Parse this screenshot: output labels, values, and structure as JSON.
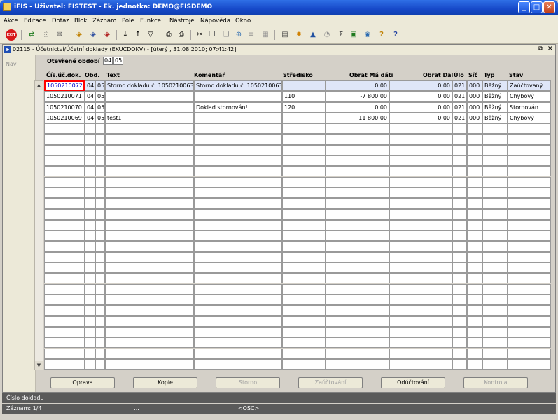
{
  "app": {
    "title": "iFIS - Uživatel: FISTEST - Ek. jednotka: DEMO@FISDEMO"
  },
  "menu": [
    "Akce",
    "Editace",
    "Dotaz",
    "Blok",
    "Záznam",
    "Pole",
    "Funkce",
    "Nástroje",
    "Nápověda",
    "Okno"
  ],
  "toolbar": {
    "exit_label": "EXIT",
    "icons": [
      "save-icon",
      "print-preview-icon",
      "mail-icon",
      "query-icon",
      "query-run-icon",
      "query-cancel-icon",
      "sort-asc-icon",
      "sort-desc-icon",
      "filter-icon",
      "print-icon",
      "print-setup-icon",
      "cut-icon",
      "copy-icon",
      "paste-icon",
      "insert-record-icon",
      "delete-record-icon",
      "grid-icon",
      "calculator-icon",
      "sun-icon",
      "attachment-icon",
      "chart-icon",
      "sum-icon",
      "excel-icon",
      "refresh-icon",
      "help-icon",
      "about-icon"
    ]
  },
  "window": {
    "title": "02115 - Účetnictví/Účetní doklady (EKUCDOKV) - [úterý  , 31.08.2010; 07:41:42]",
    "nav_label": "Nav",
    "period_label": "Otevřené období",
    "period_year": "04",
    "period_month": "05"
  },
  "columns": [
    "Čís.úč.dok.",
    "Obd.",
    "Text",
    "Komentář",
    "Středisko",
    "Obrat Má dáti",
    "Obrat Dal",
    "Úlo",
    "Síť",
    "Typ",
    "Stav"
  ],
  "rows": [
    {
      "cislo": "1050210072",
      "obd1": "04",
      "obd2": "05",
      "text": "Storno dokladu č. 1050210063",
      "komentar": "Storno dokladu č. 1050210063",
      "stredisko": "",
      "md": "0.00",
      "dal": "0.00",
      "ulo": "021",
      "sit": "000",
      "typ": "Běžný",
      "stav": "Zaúčtovaný"
    },
    {
      "cislo": "1050210071",
      "obd1": "04",
      "obd2": "05",
      "text": "",
      "komentar": "",
      "stredisko": "110",
      "md": "-7 800.00",
      "dal": "0.00",
      "ulo": "021",
      "sit": "000",
      "typ": "Běžný",
      "stav": "Chybový"
    },
    {
      "cislo": "1050210070",
      "obd1": "04",
      "obd2": "05",
      "text": "",
      "komentar": "Doklad stornován!",
      "stredisko": "120",
      "md": "0.00",
      "dal": "0.00",
      "ulo": "021",
      "sit": "000",
      "typ": "Běžný",
      "stav": "Stornován"
    },
    {
      "cislo": "1050210069",
      "obd1": "04",
      "obd2": "05",
      "text": "test1",
      "komentar": "",
      "stredisko": "",
      "md": "11 800.00",
      "dal": "0.00",
      "ulo": "021",
      "sit": "000",
      "typ": "Běžný",
      "stav": "Chybový"
    }
  ],
  "buttons": [
    {
      "label": "Oprava",
      "enabled": true
    },
    {
      "label": "Kopie",
      "enabled": true
    },
    {
      "label": "Storno",
      "enabled": false
    },
    {
      "label": "Zaúčtování",
      "enabled": false
    },
    {
      "label": "Odúčtování",
      "enabled": true
    },
    {
      "label": "Kontrola",
      "enabled": false
    }
  ],
  "status": {
    "hint": "Číslo dokladu",
    "record": "Záznam: 1/4",
    "seg2": "...",
    "seg3": "<OSC>"
  }
}
